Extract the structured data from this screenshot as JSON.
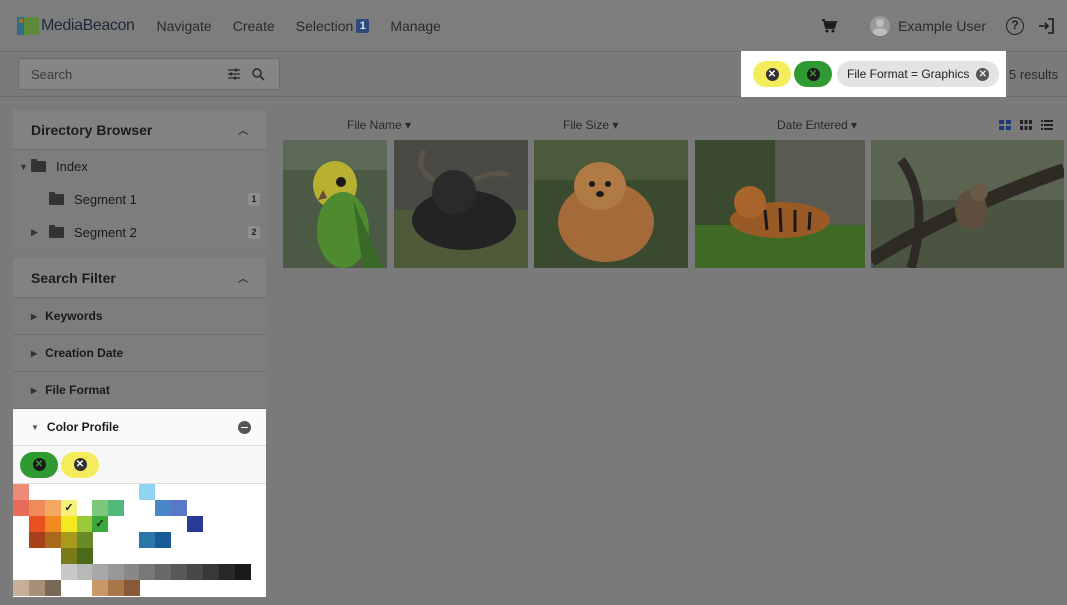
{
  "app": {
    "brand": "MediaBeacon",
    "nav": [
      "Navigate",
      "Create",
      "Selection",
      "Manage"
    ],
    "selection_count": "1",
    "user_name": "Example User",
    "help_glyph": "?"
  },
  "search": {
    "placeholder": "Search"
  },
  "active_filters": {
    "results": "5 results",
    "file_format_chip": "File Format = Graphics",
    "chips": [
      "yellow color",
      "green color",
      "File Format = Graphics"
    ]
  },
  "directory_browser": {
    "title": "Directory Browser",
    "items": [
      {
        "label": "Index",
        "count": ""
      },
      {
        "label": "Segment 1",
        "count": "1"
      },
      {
        "label": "Segment 2",
        "count": "2"
      }
    ]
  },
  "search_filter": {
    "title": "Search Filter",
    "sections": [
      "Keywords",
      "Creation Date",
      "File Format",
      "Color Profile"
    ]
  },
  "color_profile": {
    "selected": [
      "green",
      "yellow"
    ],
    "colors": {
      "accent_yellow": "#f4ec5a",
      "accent_green": "#2f9a32"
    }
  },
  "columns": [
    "File Name",
    "File Size",
    "Date Entered"
  ],
  "thumbnails": [
    "budgerigar",
    "yak",
    "pomeranian",
    "tiger",
    "squirrel"
  ]
}
